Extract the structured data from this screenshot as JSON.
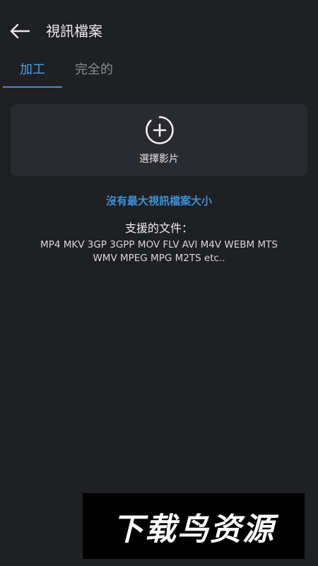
{
  "header": {
    "title": "視訊檔案"
  },
  "tabs": [
    {
      "label": "加工",
      "active": true
    },
    {
      "label": "完全的",
      "active": false
    }
  ],
  "picker": {
    "label": "選擇影片",
    "icon": "add-circle-icon"
  },
  "notice": {
    "text": "沒有最大視訊檔案大小"
  },
  "supported": {
    "title": "支援的文件：",
    "formats_line1": "MP4 MKV 3GP 3GPP MOV FLV AVI M4V WEBM MTS",
    "formats_line2": "WMV MPEG MPG M2TS etc.."
  },
  "watermark": {
    "text": "下载鸟资源"
  },
  "colors": {
    "background": "#1f2024",
    "card": "#2a2b30",
    "accent": "#3b8fd8",
    "inactive_tab": "#8a8b90",
    "text": "#ececee"
  }
}
